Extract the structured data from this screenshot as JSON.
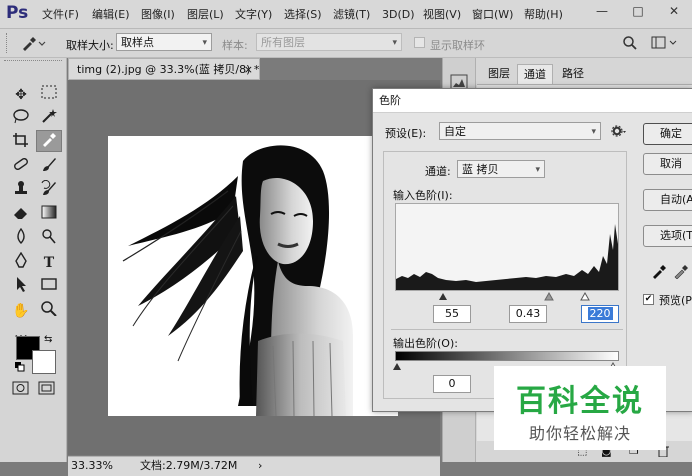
{
  "app": {
    "logo": "Ps"
  },
  "menu": [
    "文件(F)",
    "编辑(E)",
    "图像(I)",
    "图层(L)",
    "文字(Y)",
    "选择(S)",
    "滤镜(T)",
    "3D(D)",
    "视图(V)",
    "窗口(W)",
    "帮助(H)"
  ],
  "window_controls": {
    "minimize": "—",
    "maximize": "□",
    "close": "✕"
  },
  "options_bar": {
    "sample_size_label": "取样大小:",
    "sample_size_value": "取样点",
    "sample_label": "样本:",
    "sample_value": "所有图层",
    "show_ring_label": "显示取样环"
  },
  "document": {
    "tab_title": "timg (2).jpg @ 33.3%(蓝 拷贝/8) *",
    "tab_close": "×",
    "zoom": "33.33%",
    "doc_info": "文档:2.79M/3.72M"
  },
  "panel_tabs": [
    "图层",
    "通道",
    "路径"
  ],
  "levels_dialog": {
    "title": "色阶",
    "preset_label": "预设(E):",
    "preset_value": "自定",
    "channel_label": "通道:",
    "channel_value": "蓝 拷贝",
    "input_levels_label": "输入色阶(I):",
    "input_black": "55",
    "input_mid": "0.43",
    "input_white": "220",
    "output_levels_label": "输出色阶(O):",
    "output_black": "0",
    "buttons": [
      "确定",
      "取消",
      "自动(A)",
      "选项(T)..."
    ],
    "preview_label": "预览(P)"
  },
  "watermark": {
    "title": "百科全说",
    "subtitle": "助你轻松解决"
  },
  "colors": {
    "ui_gray": "#d6d6d6",
    "canvas_bg": "#707070",
    "watermark_green": "#27a844",
    "highlight_blue": "#3b7bd8"
  },
  "icons": [
    "eyedropper-icon",
    "search-icon",
    "panel-icon",
    "gear-icon",
    "eyedropper-black-icon",
    "eyedropper-gray-icon",
    "eyedropper-white-icon",
    "trash-icon"
  ]
}
